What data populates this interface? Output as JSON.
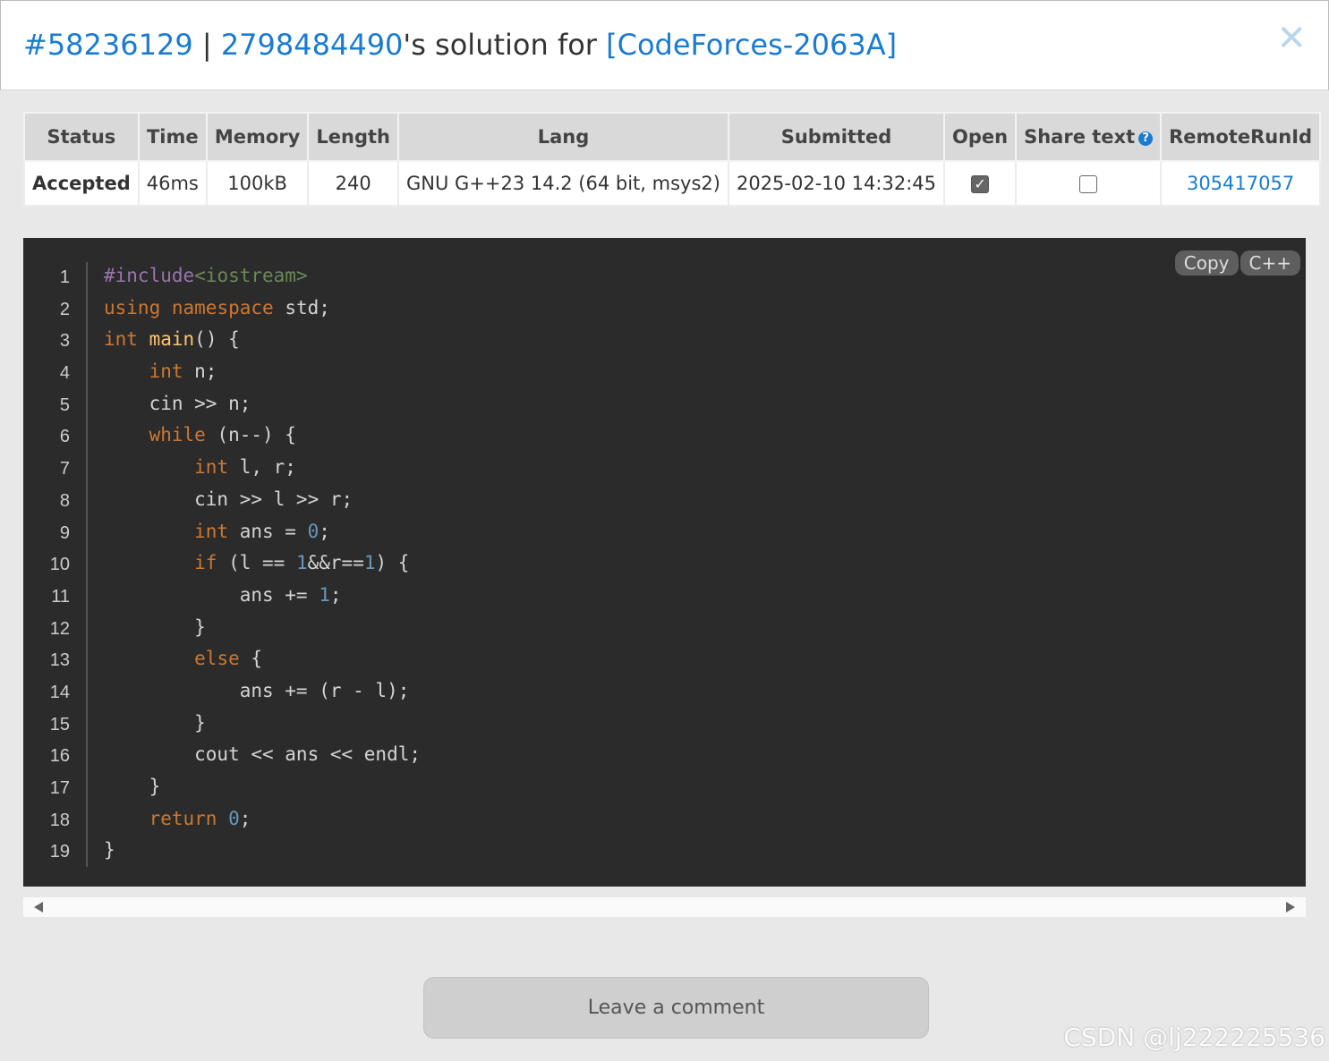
{
  "header": {
    "run_id": "#58236129",
    "separator": " | ",
    "user": "2798484490",
    "mid_text": "'s solution for ",
    "problem": "[CodeForces-2063A]",
    "close_symbol": "✕"
  },
  "table": {
    "headers": [
      "Status",
      "Time",
      "Memory",
      "Length",
      "Lang",
      "Submitted",
      "Open",
      "Share text",
      "RemoteRunId"
    ],
    "row": {
      "status": "Accepted",
      "time": "46ms",
      "memory": "100kB",
      "length": "240",
      "lang": "GNU G++23 14.2 (64 bit, msys2)",
      "submitted": "2025-02-10 14:32:45",
      "open": true,
      "share": false,
      "remote_run_id": "305417057"
    },
    "help_icon": "?"
  },
  "code": {
    "copy_label": "Copy",
    "lang_label": "C++",
    "line_numbers": [
      "1",
      "2",
      "3",
      "4",
      "5",
      "6",
      "7",
      "8",
      "9",
      "10",
      "11",
      "12",
      "13",
      "14",
      "15",
      "16",
      "17",
      "18",
      "19"
    ]
  },
  "comment_button": "Leave a comment",
  "watermark": "CSDN @lj222225536",
  "colors": {
    "accent": "#1a7bd1",
    "accepted": "#48b04c",
    "code_bg": "#2b2b2b"
  }
}
